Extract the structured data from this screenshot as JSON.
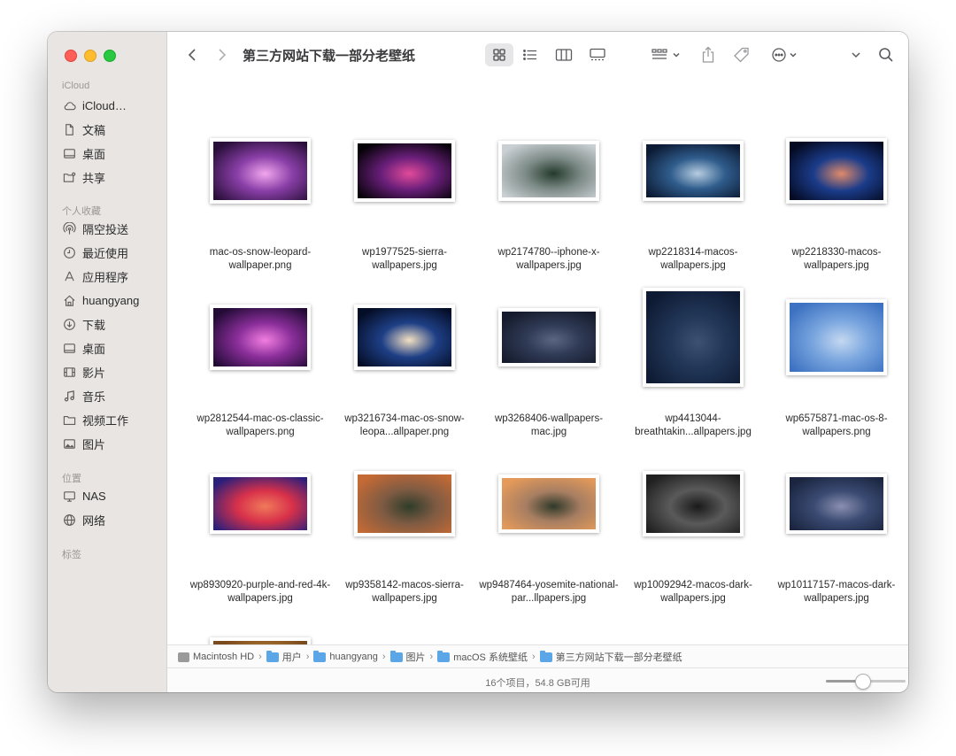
{
  "window": {
    "title": "第三方网站下载一部分老壁纸"
  },
  "sidebar": {
    "icloud_header": "iCloud",
    "icloud_items": [
      {
        "label": "iCloud…",
        "icon": "cloud-icon"
      },
      {
        "label": "文稿",
        "icon": "document-icon"
      },
      {
        "label": "桌面",
        "icon": "desktop-icon"
      },
      {
        "label": "共享",
        "icon": "shared-folder-icon"
      }
    ],
    "favorites_header": "个人收藏",
    "favorite_items": [
      {
        "label": "隔空投送",
        "icon": "airdrop-icon"
      },
      {
        "label": "最近使用",
        "icon": "clock-icon"
      },
      {
        "label": "应用程序",
        "icon": "applications-icon"
      },
      {
        "label": "huangyang",
        "icon": "home-icon"
      },
      {
        "label": "下载",
        "icon": "download-icon"
      },
      {
        "label": "桌面",
        "icon": "desktop-icon"
      },
      {
        "label": "影片",
        "icon": "film-icon"
      },
      {
        "label": "音乐",
        "icon": "music-icon"
      },
      {
        "label": "视频工作",
        "icon": "folder-icon"
      },
      {
        "label": "图片",
        "icon": "photo-icon"
      }
    ],
    "locations_header": "位置",
    "location_items": [
      {
        "label": "NAS",
        "icon": "monitor-icon"
      },
      {
        "label": "网络",
        "icon": "globe-icon"
      }
    ],
    "tags_header": "标签"
  },
  "files": [
    {
      "name": "mac-os-snow-leopard-wallpaper.png",
      "colors": [
        "#2a0f3a",
        "#8a3fa8",
        "#f2a6ee"
      ]
    },
    {
      "name": "wp1977525-sierra-wallpapers.jpg",
      "colors": [
        "#050208",
        "#6a1f7a",
        "#e24a9a"
      ]
    },
    {
      "name": "wp2174780--iphone-x-wallpapers.jpg",
      "colors": [
        "#c9cfd3",
        "#7c8a86",
        "#253a2c"
      ]
    },
    {
      "name": "wp2218314-macos-wallpapers.jpg",
      "colors": [
        "#0c1a33",
        "#2f5c8c",
        "#b6cde0"
      ]
    },
    {
      "name": "wp2218330-macos-wallpapers.jpg",
      "colors": [
        "#040a22",
        "#1b3c8a",
        "#e08a6a"
      ]
    },
    {
      "name": "wp2812544-mac-os-classic-wallpapers.png",
      "colors": [
        "#230b36",
        "#8a2e9a",
        "#f27ee0"
      ]
    },
    {
      "name": "wp3216734-mac-os-snow-leopa...allpaper.png",
      "colors": [
        "#040d26",
        "#1e3f86",
        "#f3e0c2"
      ]
    },
    {
      "name": "wp3268406-wallpapers-mac.jpg",
      "colors": [
        "#151b2c",
        "#2f3a55",
        "#5a6683"
      ]
    },
    {
      "name": "wp4413044-breathtakin...allpapers.jpg",
      "colors": [
        "#0e1a33",
        "#213657",
        "#3d5272"
      ]
    },
    {
      "name": "wp6575871-mac-os-8-wallpapers.png",
      "colors": [
        "#3d72c2",
        "#7aa6df",
        "#c4d8f0"
      ]
    },
    {
      "name": "wp8930920-purple-and-red-4k-wallpapers.jpg",
      "colors": [
        "#2c1f7a",
        "#d8314a",
        "#f07a5a"
      ]
    },
    {
      "name": "wp9358142-macos-sierra-wallpapers.jpg",
      "colors": [
        "#c46a35",
        "#7f5b43",
        "#2f3d2a"
      ]
    },
    {
      "name": "wp9487464-yosemite-national-par...llpapers.jpg",
      "colors": [
        "#e49a5a",
        "#a77e62",
        "#2f3a2a"
      ]
    },
    {
      "name": "wp10092942-macos-dark-wallpapers.jpg",
      "colors": [
        "#202020",
        "#5a5a5a",
        "#1a1a1a"
      ]
    },
    {
      "name": "wp10117157-macos-dark-wallpapers.jpg",
      "colors": [
        "#1b2540",
        "#3a4a72",
        "#8a8fb0"
      ]
    },
    {
      "name": "",
      "colors": [
        "#7a4a1c",
        "#c38a3c",
        "#e7b55c"
      ]
    }
  ],
  "pathbar": {
    "crumbs": [
      "Macintosh HD",
      "用户",
      "huangyang",
      "图片",
      "macOS 系统壁纸",
      "第三方网站下载一部分老壁纸"
    ]
  },
  "status": {
    "text": "16个项目，54.8 GB可用",
    "zoom_level": 0.45
  },
  "icons": {
    "back": "chevron-left-icon",
    "forward": "chevron-right-icon",
    "view_icons": "grid-view-icon",
    "view_list": "list-view-icon",
    "view_columns": "column-view-icon",
    "view_gallery": "gallery-view-icon",
    "group": "group-by-icon",
    "share": "share-icon",
    "tag": "tag-icon",
    "more": "more-options-icon",
    "search": "search-icon"
  }
}
